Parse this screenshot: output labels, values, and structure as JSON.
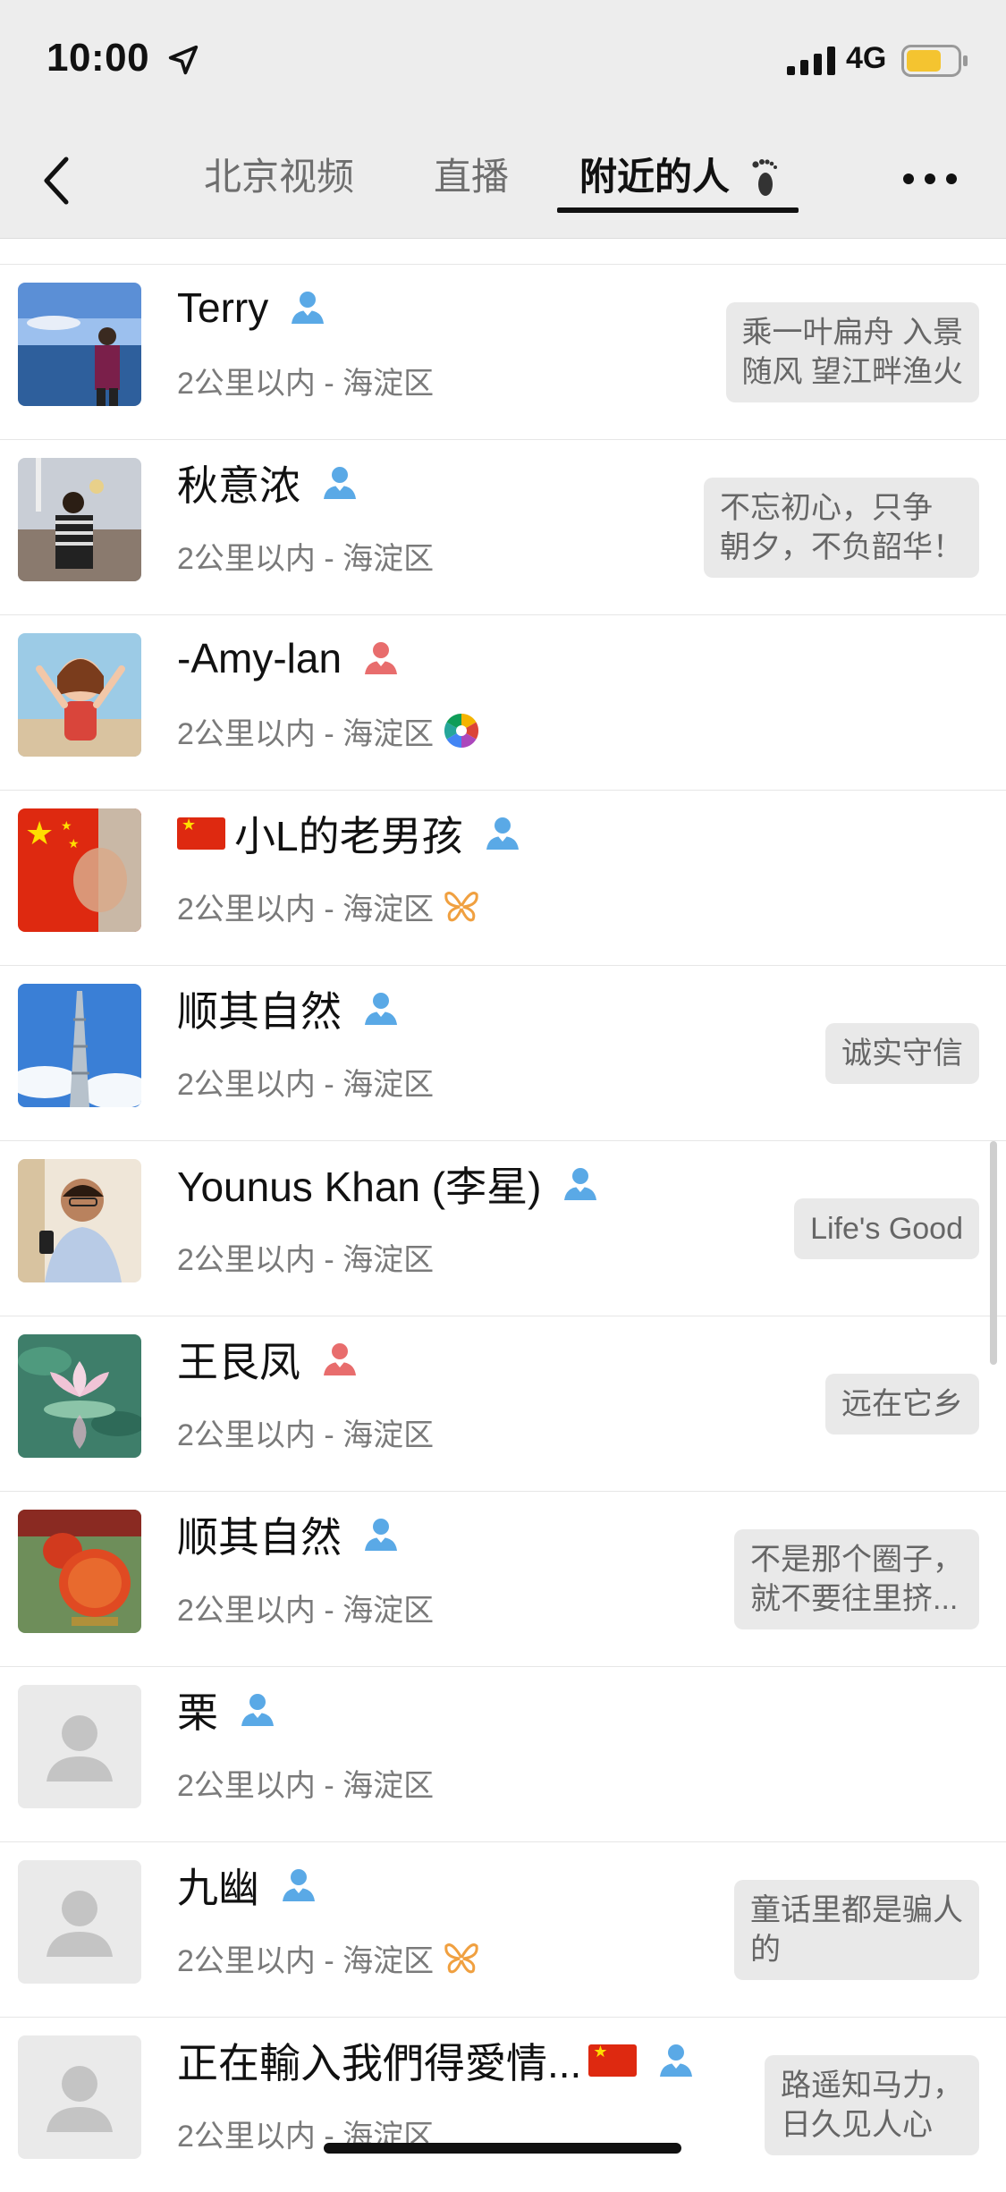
{
  "status": {
    "time": "10:00",
    "network": "4G",
    "battery_color": "#f4c430"
  },
  "nav": {
    "tabs": [
      {
        "label": "北京视频",
        "active": false
      },
      {
        "label": "直播",
        "active": false
      },
      {
        "label": "附近的人",
        "active": true
      }
    ]
  },
  "colors": {
    "male": "#5aa9e6",
    "female": "#e86d6d"
  },
  "people": [
    {
      "name": "Terry",
      "gender": "male",
      "location": "2公里以内 - 海淀区",
      "signature": "乘一叶扁舟 入景\n随风 望江畔渔火",
      "avatar": "photo-sea"
    },
    {
      "name": "秋意浓",
      "gender": "male",
      "location": "2公里以内 - 海淀区",
      "signature": "不忘初心，只争\n朝夕，不负韶华！",
      "avatar": "photo-square"
    },
    {
      "name": "-Amy-lan",
      "gender": "female",
      "location": "2公里以内 - 海淀区",
      "signature": "",
      "extra_icon": "colorful-shutter-icon",
      "avatar": "cartoon-girl"
    },
    {
      "name": "小L的老男孩",
      "gender": "male",
      "location": "2公里以内 - 海淀区",
      "signature": "",
      "extra_icon": "butterfly-icon",
      "flag": "before",
      "avatar": "flag-face"
    },
    {
      "name": "顺其自然",
      "gender": "male",
      "location": "2公里以内 - 海淀区",
      "signature": "诚实守信",
      "avatar": "tower"
    },
    {
      "name": "Younus Khan (李星)",
      "gender": "male",
      "location": "2公里以内 - 海淀区",
      "signature": "Life's Good",
      "avatar": "man-phone"
    },
    {
      "name": "王艮凤",
      "gender": "female",
      "location": "2公里以内 - 海淀区",
      "signature": "远在它乡",
      "avatar": "lotus"
    },
    {
      "name": "顺其自然",
      "gender": "male",
      "location": "2公里以内 - 海淀区",
      "signature": "不是那个圈子，\n就不要往里挤...",
      "avatar": "lanterns"
    },
    {
      "name": "栗",
      "gender": "male",
      "location": "2公里以内 - 海淀区",
      "signature": "",
      "avatar": "default"
    },
    {
      "name": "九幽",
      "gender": "male",
      "location": "2公里以内 - 海淀区",
      "signature": "童话里都是骗人\n的",
      "extra_icon": "butterfly-icon",
      "avatar": "default"
    },
    {
      "name": "正在輸入我們得愛情...",
      "gender": "male",
      "location": "2公里以内 - 海淀区",
      "signature": "路遥知马力，\n日久见人心",
      "flag": "after",
      "avatar": "default"
    }
  ]
}
